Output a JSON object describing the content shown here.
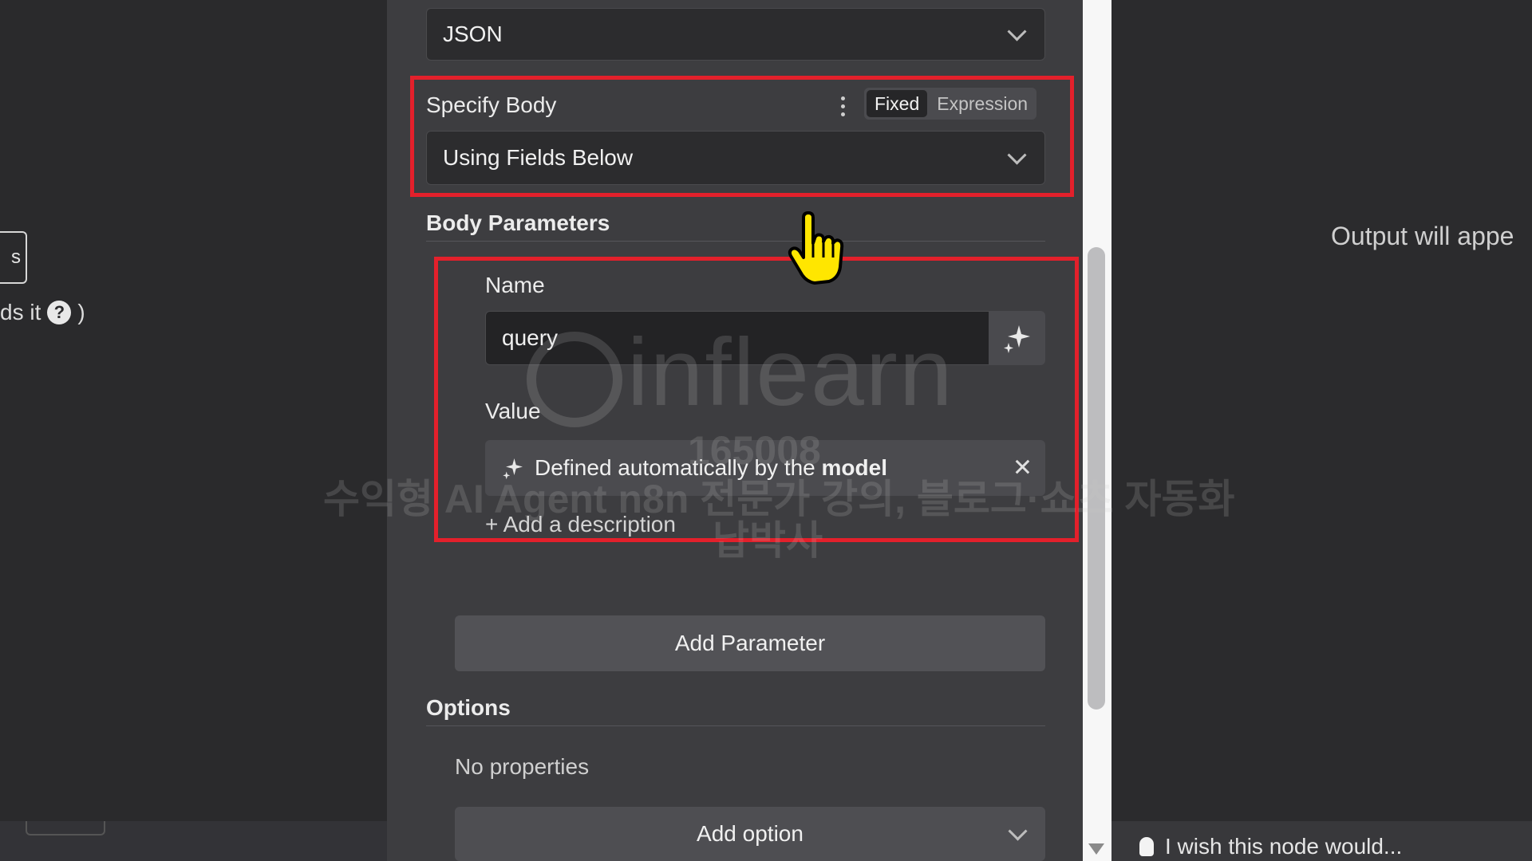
{
  "left": {
    "box_text": "s",
    "hint_text": "ds it",
    "hint_suffix": ")"
  },
  "panel": {
    "format_select": "JSON",
    "specify_body": {
      "label": "Specify Body",
      "mode_fixed": "Fixed",
      "mode_expression": "Expression",
      "select_value": "Using Fields Below"
    },
    "body_parameters": {
      "title": "Body Parameters",
      "name_label": "Name",
      "name_value": "query",
      "value_label": "Value",
      "value_auto_prefix": "Defined automatically by the",
      "value_auto_bold": "model",
      "add_description": "+ Add a description"
    },
    "add_parameter": "Add Parameter",
    "options": {
      "title": "Options",
      "empty": "No properties",
      "add_option": "Add option"
    }
  },
  "right": {
    "output_text": "Output will appe",
    "wish_text": "I wish this node would..."
  },
  "watermark": {
    "logo": "inflearn",
    "id": "165008",
    "course": "수익형 AI Agent n8n 전문가 강의, 블로그·쇼츠 자동화",
    "author": "납박사"
  },
  "colors": {
    "highlight": "#e3202b",
    "panel_bg": "#3d3d40",
    "cursor": "#ffe600"
  }
}
